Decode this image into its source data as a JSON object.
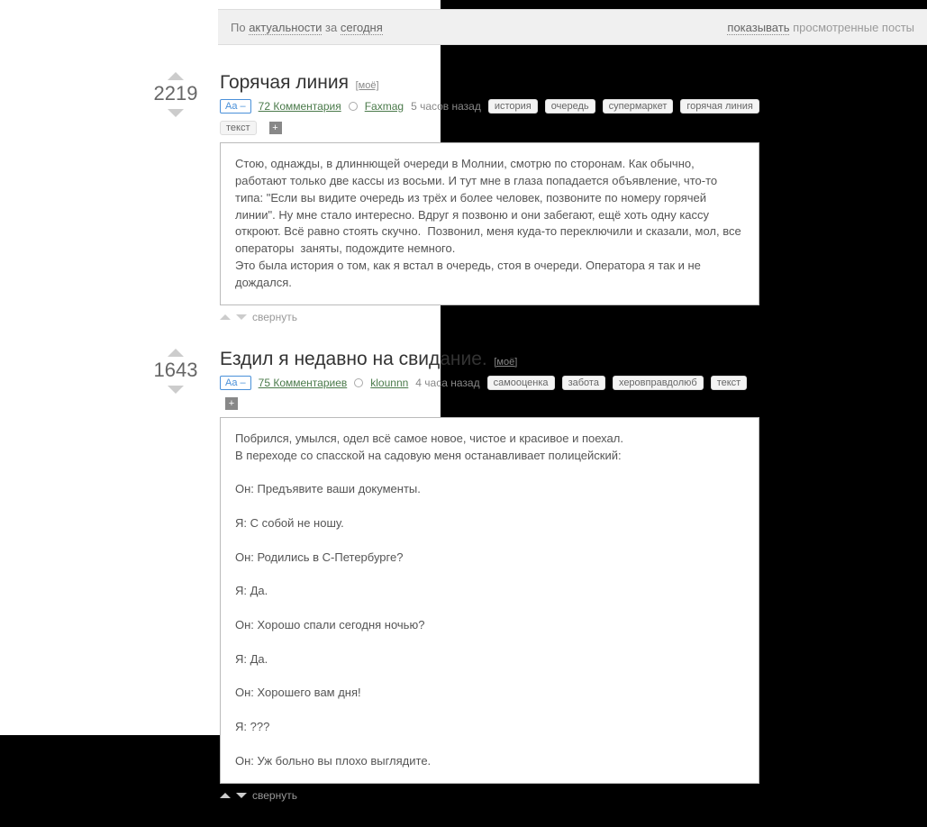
{
  "topbar": {
    "sort_prefix": "По ",
    "sort_link": "актуальности",
    "period_prefix": " за ",
    "period_link": "сегодня",
    "show_label": "показывать",
    "show_suffix": " просмотренные посты"
  },
  "common": {
    "aa_label": "Aa –",
    "collapse_label": "свернуть",
    "plus_label": "+",
    "mytag_label": "[моё]"
  },
  "posts": [
    {
      "score": "2219",
      "title": "Горячая линия",
      "show_mytag": true,
      "comments": "72 Комментария",
      "author": "Faxmag",
      "time": "5 часов назад",
      "tags": [
        "история",
        "очередь",
        "супермаркет",
        "горячая линия",
        "текст"
      ],
      "content": "Стою, однажды, в длиннющей очереди в Молнии, смотрю по сторонам. Как обычно, работают только две кассы из восьми. И тут мне в глаза попадается объявление, что-то типа: \"Если вы видите очередь из трёх и более человек, позвоните по номеру горячей линии\". Ну мне стало интересно. Вдруг я позвоню и они забегают, ещё хоть одну кассу откроют. Всё равно стоять скучно.  Позвонил, меня куда-то переключили и сказали, мол, все операторы  заняты, подождите немного.\nЭто была история о том, как я встал в очередь, стоя в очереди. Оператора я так и не дождался."
    },
    {
      "score": "1643",
      "title": "Ездил я недавно на свидание.",
      "show_mytag": true,
      "comments": "75 Комментариев",
      "author": "klounnn",
      "time": "4 часа назад",
      "tags": [
        "самооценка",
        "забота",
        "херовправдолюб",
        "текст"
      ],
      "content": "Побрился, умылся, одел всё самое новое, чистое и красивое и поехал.\nВ переходе со спасской на садовую меня останавливает полицейский:\n\nОн: Предъявите ваши документы.\n\nЯ: С собой не ношу.\n\nОн: Родились в С-Петербурге?\n\nЯ: Да.\n\nОн: Хорошо спали сегодня ночью?\n\nЯ: Да.\n\nОн: Хорошего вам дня!\n\nЯ: ???\n\nОн: Уж больно вы плохо выглядите."
    }
  ]
}
